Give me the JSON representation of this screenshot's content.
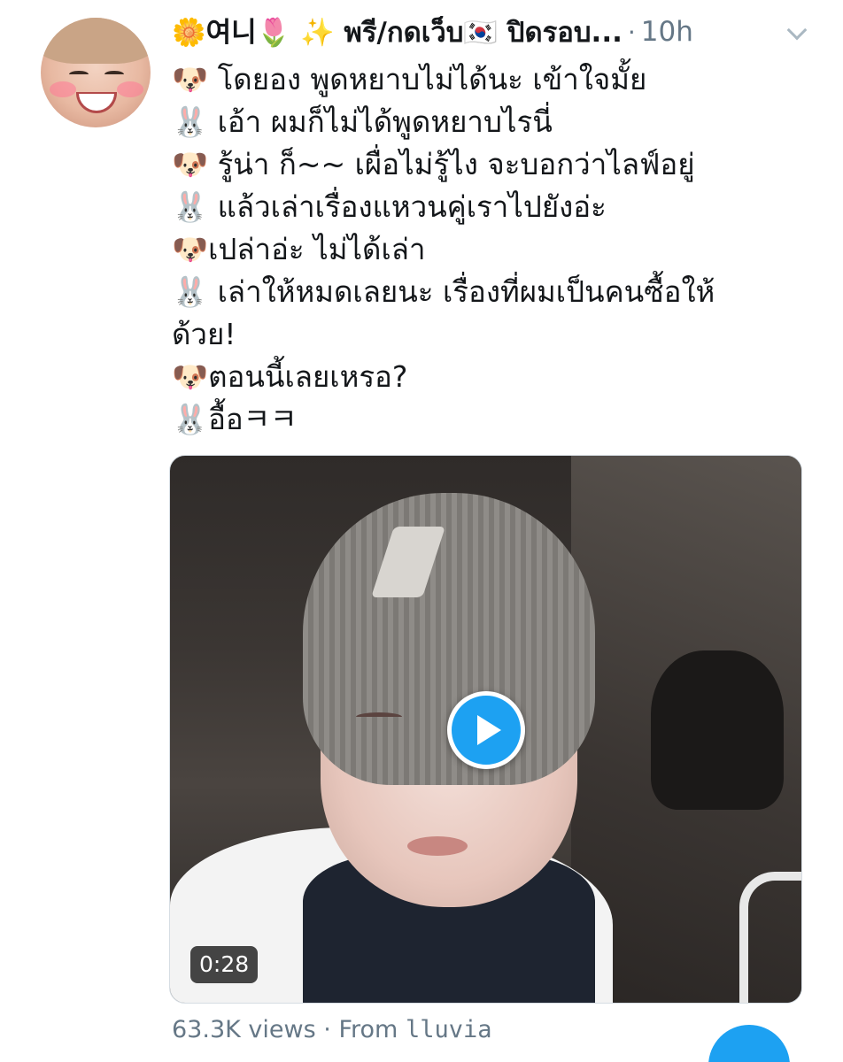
{
  "tweet": {
    "display_name": "🌼여니🌷 ✨ พรี/กดเว็บ🇰🇷 ปิดรอบ...",
    "separator": "·",
    "timestamp": "10h",
    "lines": [
      "🐶 โดยอง พูดหยาบไม่ได้นะ เข้าใจมั้ย",
      "🐰 เอ้า ผมก็ไม่ได้พูดหยาบไรนี่",
      "🐶 รู้น่า ก็~~ เผื่อไม่รู้ไง จะบอกว่าไลฟ์อยู่",
      "🐰 แล้วเล่าเรื่องแหวนคู่เราไปยังอ่ะ",
      "🐶เปล่าอ่ะ ไม่ได้เล่า",
      "🐰 เล่าให้หมดเลยนะ เรื่องที่ผมเป็นคนซื้อให้",
      "ด้วย!",
      "🐶ตอนนี้เลยเหรอ?",
      "🐰อื้อㅋㅋ"
    ]
  },
  "video": {
    "duration": "0:28"
  },
  "footer": {
    "views": "63.3K views",
    "separator": "·",
    "from_label": "From",
    "source": "lluvia"
  },
  "icons": {
    "more": "chevron-down-icon",
    "play": "play-icon"
  },
  "colors": {
    "accent": "#1da1f2",
    "muted_text": "#657786"
  }
}
